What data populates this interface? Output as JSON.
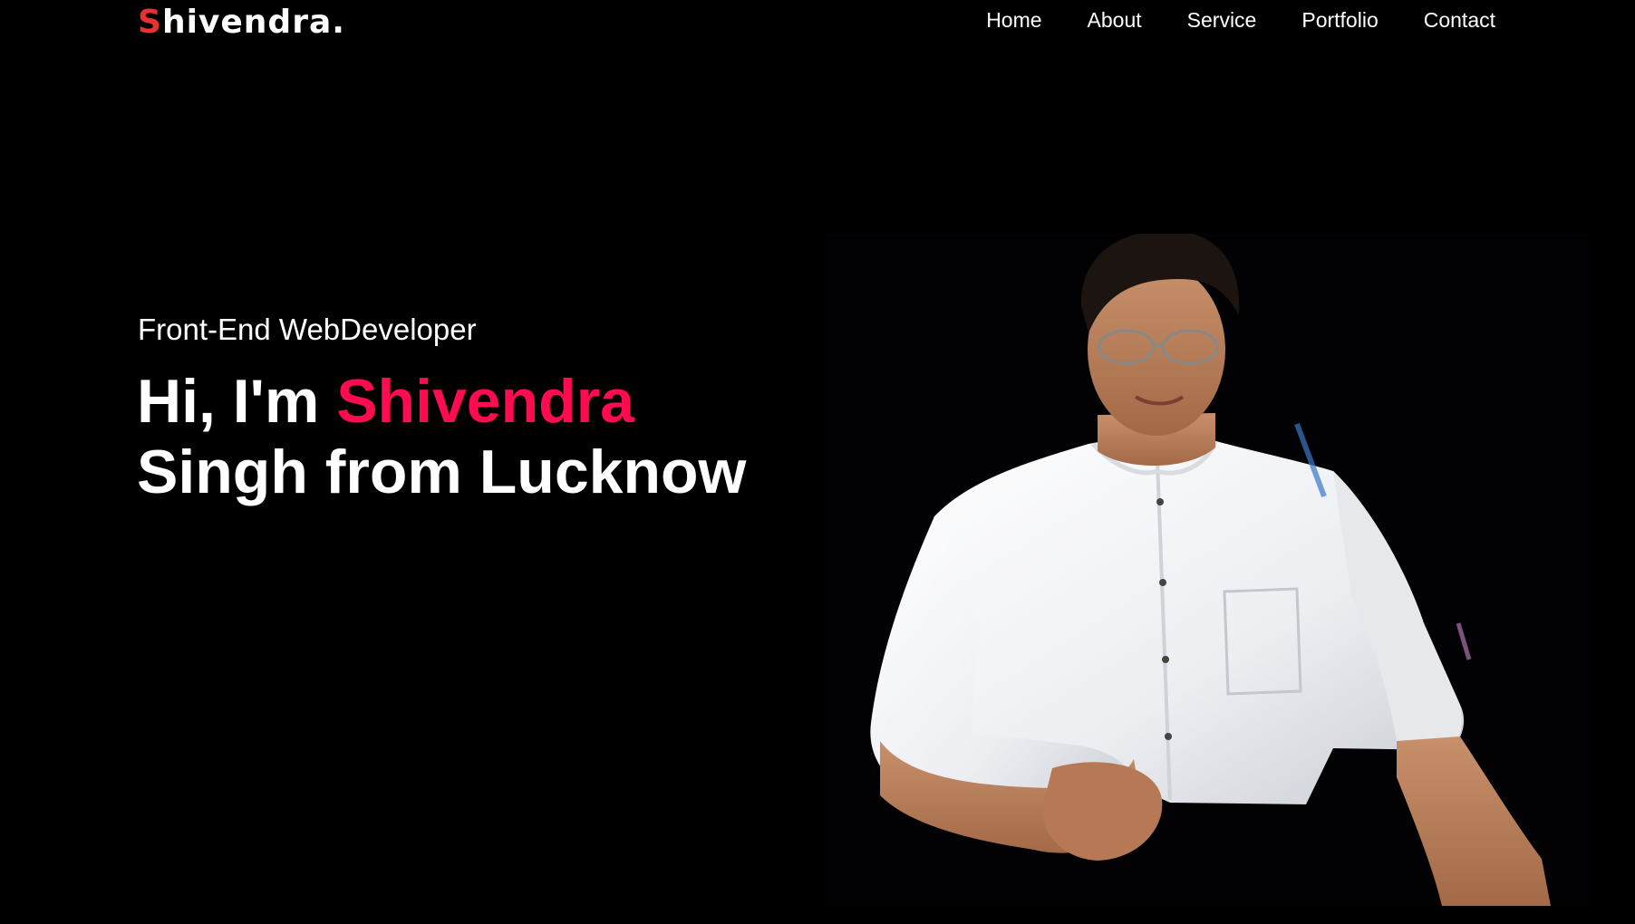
{
  "header": {
    "logo_initial": "S",
    "logo_rest": "hivendra.",
    "nav": [
      {
        "label": "Home"
      },
      {
        "label": "About"
      },
      {
        "label": "Service"
      },
      {
        "label": "Portfolio"
      },
      {
        "label": "Contact"
      }
    ]
  },
  "hero": {
    "subtitle": "Front-End WebDeveloper",
    "greeting": "Hi, I'm ",
    "name": "Shivendra",
    "line2": "Singh from Lucknow",
    "photo_icon": "person-portrait"
  },
  "colors": {
    "background": "#000000",
    "logo_accent": "#e8322f",
    "name_accent": "#ff0b4f",
    "text": "#ffffff"
  }
}
